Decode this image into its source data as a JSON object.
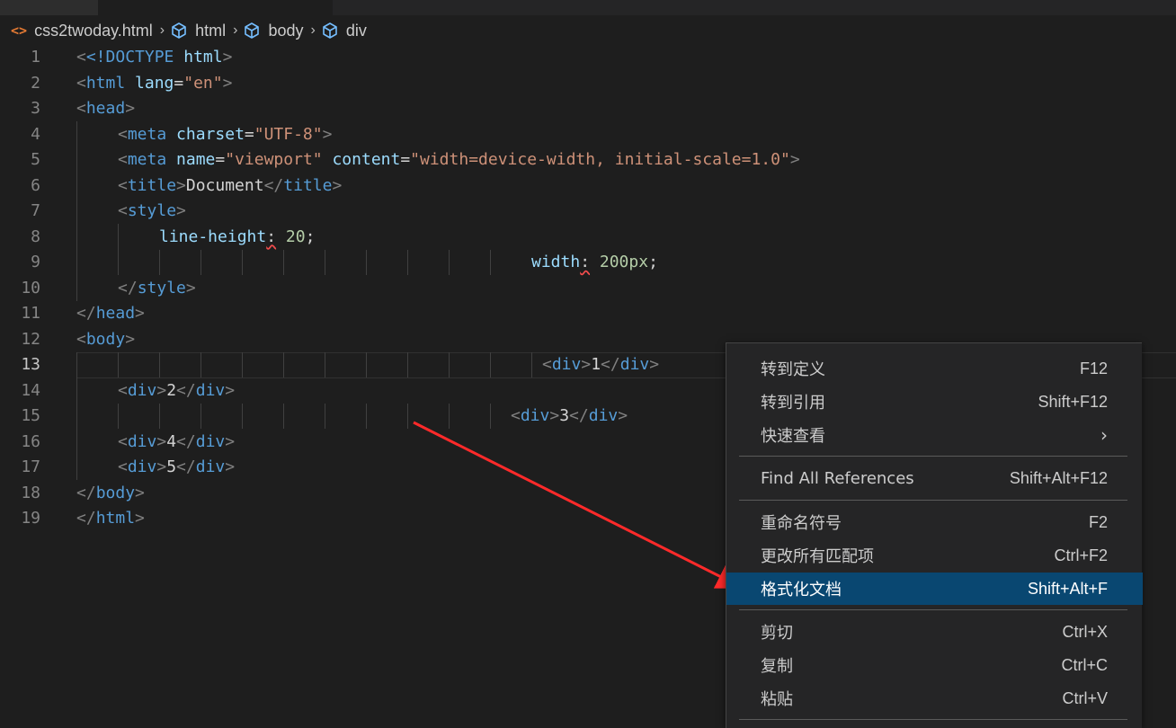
{
  "breadcrumb": {
    "file": "css2twoday.html",
    "items": [
      "html",
      "body",
      "div"
    ]
  },
  "editor": {
    "line_numbers": [
      "1",
      "2",
      "3",
      "4",
      "5",
      "6",
      "7",
      "8",
      "9",
      "10",
      "11",
      "12",
      "13",
      "14",
      "15",
      "16",
      "17",
      "18",
      "19"
    ],
    "current_line": "13"
  },
  "code": {
    "doctype": "<!DOCTYPE",
    "html_kw": "html",
    "lt": "<",
    "gt": ">",
    "lt_slash": "</",
    "eq": "=",
    "tag_html": "html",
    "attr_lang": "lang",
    "val_en": "\"en\"",
    "tag_head": "head",
    "tag_meta": "meta",
    "attr_charset": "charset",
    "val_utf8": "\"UTF-8\"",
    "attr_name": "name",
    "val_viewport": "\"viewport\"",
    "attr_content": "content",
    "val_content": "\"width=device-width, initial-scale=1.0\"",
    "tag_title": "title",
    "title_text": "Document",
    "tag_style": "style",
    "prop_lineheight": "line-height",
    "colon": ":",
    "val_20": "20",
    "semi": ";",
    "prop_width": "width",
    "val_200px": "200px",
    "tag_body": "body",
    "tag_div": "div",
    "div1": "1",
    "div2": "2",
    "div3": "3",
    "div4": "4",
    "div5": "5"
  },
  "context_menu": {
    "items": [
      {
        "label": "转到定义",
        "shortcut": "F12"
      },
      {
        "label": "转到引用",
        "shortcut": "Shift+F12"
      },
      {
        "label": "快速查看",
        "shortcut": ""
      },
      {
        "label": "Find All References",
        "shortcut": "Shift+Alt+F12"
      },
      {
        "label": "重命名符号",
        "shortcut": "F2"
      },
      {
        "label": "更改所有匹配项",
        "shortcut": "Ctrl+F2"
      },
      {
        "label": "格式化文档",
        "shortcut": "Shift+Alt+F"
      },
      {
        "label": "剪切",
        "shortcut": "Ctrl+X"
      },
      {
        "label": "复制",
        "shortcut": "Ctrl+C"
      },
      {
        "label": "粘贴",
        "shortcut": "Ctrl+V"
      }
    ],
    "selected_index": 6
  },
  "colors": {
    "background": "#1e1e1e",
    "selection": "#094771",
    "arrow": "#ff2a2a",
    "tag": "#569cd6",
    "attribute": "#9cdcfe",
    "string": "#ce9178"
  },
  "icons": {
    "file": "html-file-icon",
    "symbol": "cube-icon",
    "submenu": "chevron-right-icon"
  }
}
